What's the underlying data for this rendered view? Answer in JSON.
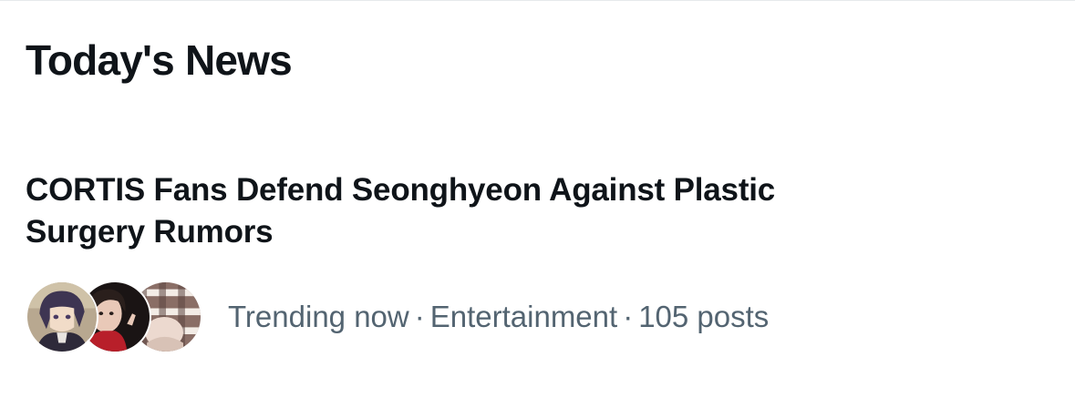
{
  "section": {
    "title": "Today's News"
  },
  "news_item": {
    "headline": "CORTIS Fans Defend Seonghyeon Against Plastic Surgery Rumors",
    "status": "Trending now",
    "separator": "·",
    "category": "Entertainment",
    "post_count": "105 posts",
    "avatars": [
      "anime-character-avatar",
      "person-photo-avatar",
      "plaid-scarf-avatar"
    ]
  },
  "colors": {
    "primary_text": "#0f1419",
    "secondary_text": "#536471",
    "divider": "#e6e9ec",
    "background": "#ffffff"
  }
}
